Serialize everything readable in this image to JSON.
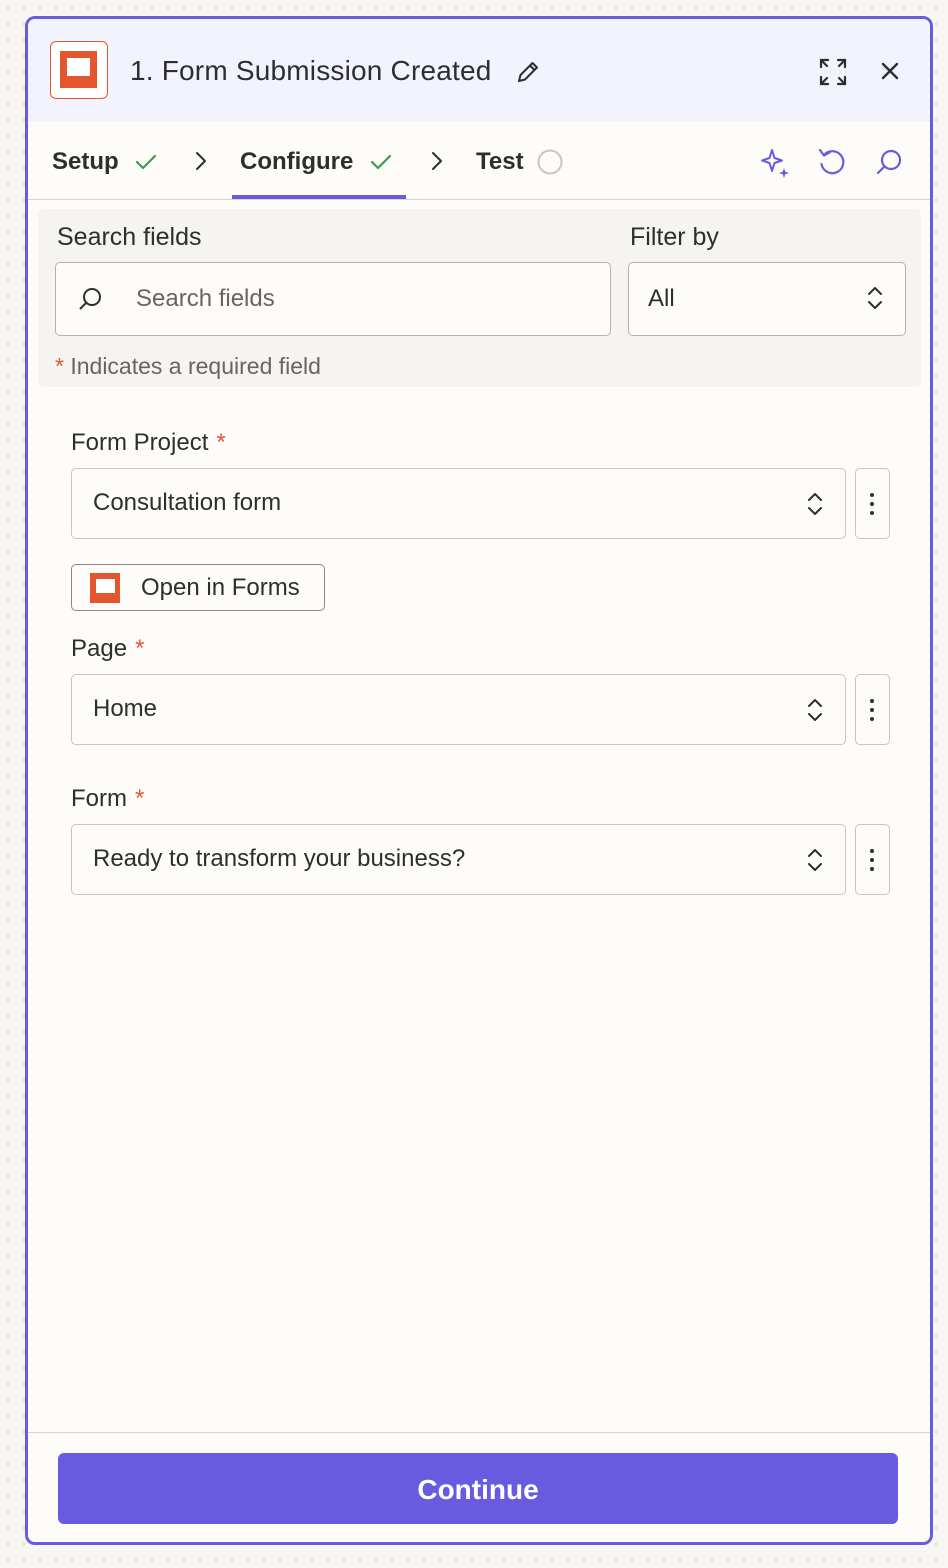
{
  "header": {
    "title": "1. Form Submission Created",
    "icons": [
      "app-logo",
      "edit-pencil-icon",
      "expand-icon",
      "close-icon"
    ]
  },
  "tabs": [
    {
      "label": "Setup",
      "status": "complete"
    },
    {
      "label": "Configure",
      "status": "complete",
      "active": true
    },
    {
      "label": "Test",
      "status": "pending"
    }
  ],
  "toolbar_icons": [
    "sparkle-ai-icon",
    "refresh-icon",
    "search-icon"
  ],
  "search": {
    "label": "Search fields",
    "placeholder": "Search fields"
  },
  "filter": {
    "label": "Filter by",
    "value": "All"
  },
  "required_note": {
    "star": "*",
    "text": "Indicates a required field"
  },
  "fields": [
    {
      "label": "Form Project",
      "star": "*",
      "value": "Consultation form"
    },
    {
      "label": "Page",
      "star": "*",
      "value": "Home"
    },
    {
      "label": "Form",
      "star": "*",
      "value": "Ready to transform your business?"
    }
  ],
  "open_button": {
    "label": "Open in Forms"
  },
  "footer": {
    "continue_label": "Continue"
  },
  "colors": {
    "accent": "#695be0",
    "brand_orange": "#e4572e",
    "success_green": "#3b9c4f",
    "header_bg": "#f3f3fd"
  }
}
